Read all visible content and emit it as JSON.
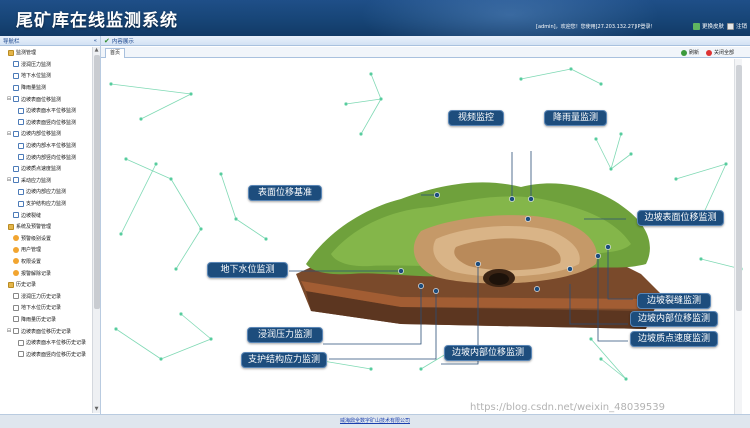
{
  "header": {
    "title": "尾矿库在线监测系统",
    "welcome": "[admin]，欢迎您！您使用[27.203.132.27]IP登录！",
    "change_skin": "更换皮肤",
    "logout": "注销"
  },
  "sidebar": {
    "title": "导航栏",
    "collapse": "«",
    "items": [
      {
        "label": "监测管理",
        "level": 0,
        "toggle": "",
        "icon": "home-icon"
      },
      {
        "label": "浸润压力监测",
        "level": 1,
        "toggle": "",
        "icon": "chart-icon"
      },
      {
        "label": "地下水位监测",
        "level": 1,
        "toggle": "",
        "icon": "chart-icon"
      },
      {
        "label": "降雨量监测",
        "level": 1,
        "toggle": "",
        "icon": "chart-icon"
      },
      {
        "label": "边坡表面位移监测",
        "level": 1,
        "toggle": "⊟",
        "icon": "chart-icon"
      },
      {
        "label": "边坡表面水平位移监测",
        "level": 2,
        "toggle": "",
        "icon": "chart-icon"
      },
      {
        "label": "边坡表面竖向位移监测",
        "level": 2,
        "toggle": "",
        "icon": "chart-icon"
      },
      {
        "label": "边坡内部位移监测",
        "level": 1,
        "toggle": "⊟",
        "icon": "chart-icon"
      },
      {
        "label": "边坡内部水平位移监测",
        "level": 2,
        "toggle": "",
        "icon": "chart-icon"
      },
      {
        "label": "边坡内部竖向位移监测",
        "level": 2,
        "toggle": "",
        "icon": "chart-icon"
      },
      {
        "label": "边坡质点速度监测",
        "level": 1,
        "toggle": "",
        "icon": "chart-icon"
      },
      {
        "label": "采动应力监测",
        "level": 1,
        "toggle": "⊟",
        "icon": "chart-icon"
      },
      {
        "label": "边坡内部应力监测",
        "level": 2,
        "toggle": "",
        "icon": "chart-icon"
      },
      {
        "label": "支护结构应力监测",
        "level": 2,
        "toggle": "",
        "icon": "chart-icon"
      },
      {
        "label": "边坡裂缝",
        "level": 1,
        "toggle": "",
        "icon": "chart-icon"
      },
      {
        "label": "系统及预警管理",
        "level": 0,
        "toggle": "",
        "icon": "home-icon"
      },
      {
        "label": "预警级别设置",
        "level": 1,
        "toggle": "",
        "icon": "star-icon"
      },
      {
        "label": "用户管理",
        "level": 1,
        "toggle": "",
        "icon": "star-icon"
      },
      {
        "label": "权限设置",
        "level": 1,
        "toggle": "",
        "icon": "star-icon"
      },
      {
        "label": "报警解除记录",
        "level": 1,
        "toggle": "",
        "icon": "star-icon"
      },
      {
        "label": "历史记录",
        "level": 0,
        "toggle": "",
        "icon": "home-icon"
      },
      {
        "label": "浸润压力历史记录",
        "level": 1,
        "toggle": "",
        "icon": "file-icon"
      },
      {
        "label": "地下水位历史记录",
        "level": 1,
        "toggle": "",
        "icon": "file-icon"
      },
      {
        "label": "降雨量历史记录",
        "level": 1,
        "toggle": "",
        "icon": "file-icon"
      },
      {
        "label": "边坡表面位移历史记录",
        "level": 1,
        "toggle": "⊟",
        "icon": "file-icon"
      },
      {
        "label": "边坡表面水平位移历史记录",
        "level": 2,
        "toggle": "",
        "icon": "file-icon"
      },
      {
        "label": "边坡表面竖向位移历史记录",
        "level": 2,
        "toggle": "",
        "icon": "file-icon"
      }
    ]
  },
  "main": {
    "panel_title": "内容展示",
    "tab_label": "首页",
    "refresh": "刷新",
    "close_all": "关闭全部"
  },
  "diagram": {
    "labels": {
      "video": "视频监控",
      "rain": "降雨量监测",
      "surface_base": "表面位移基准",
      "slope_surface": "边坡表面位移监测",
      "groundwater": "地下水位监测",
      "crack": "边坡裂缝监测",
      "seepage": "浸润压力监测",
      "internal_disp": "边坡内部位移监测",
      "particle_speed": "边坡质点速度监测",
      "support_stress": "支护结构应力监测",
      "internal_disp2": "边坡内部位移监测"
    }
  },
  "footer": {
    "company": "威海鼎全数字矿山技术有限公司"
  },
  "watermark": "https://blog.csdn.net/weixin_48039539"
}
